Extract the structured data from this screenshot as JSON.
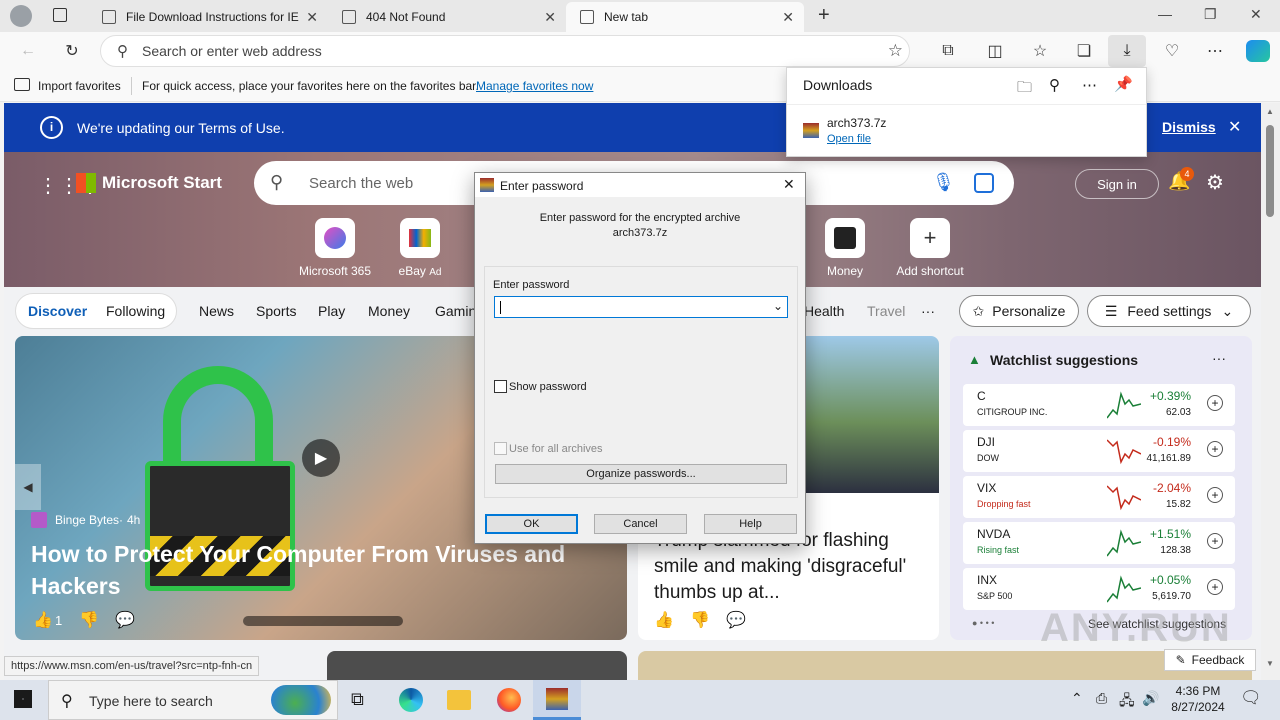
{
  "browser": {
    "tabs": [
      {
        "title": "File Download Instructions for IE",
        "active": false
      },
      {
        "title": "404 Not Found",
        "active": false
      },
      {
        "title": "New tab",
        "active": true
      }
    ],
    "address_placeholder": "Search or enter web address",
    "favorites": {
      "import_label": "Import favorites",
      "hint": "For quick access, place your favorites here on the favorites bar.",
      "manage_link": "Manage favorites now"
    }
  },
  "downloads": {
    "title": "Downloads",
    "file_name": "arch373.7z",
    "open_link": "Open file"
  },
  "banner": {
    "text": "We're updating our Terms of Use.",
    "dismiss": "Dismiss"
  },
  "msn": {
    "brand": "Microsoft Start",
    "search_placeholder": "Search the web",
    "sign_in": "Sign in",
    "notif_count": "4",
    "quicklinks": [
      {
        "label": "Microsoft 365"
      },
      {
        "label": "eBay",
        "ad": "Ad"
      },
      {
        "label": "Money"
      },
      {
        "label": "Add shortcut"
      }
    ],
    "nav": {
      "discover": "Discover",
      "following": "Following",
      "items": [
        "News",
        "Sports",
        "Play",
        "Money",
        "Gamin",
        "Health",
        "Travel"
      ],
      "more": "···",
      "personalize": "Personalize",
      "feed_settings": "Feed settings"
    },
    "feature": {
      "source": "Binge Bytes",
      "age": "4h",
      "title": "How to Protect Your Computer From Viruses and Hackers",
      "likes": "1"
    },
    "news2": {
      "title": "Trump slammed for flashing smile and making 'disgraceful' thumbs up at..."
    },
    "watchlist": {
      "title": "Watchlist suggestions",
      "more": "···",
      "items": [
        {
          "symbol": "C",
          "name": "CITIGROUP INC.",
          "change": "+0.39%",
          "price": "62.03",
          "trend": "up"
        },
        {
          "symbol": "DJI",
          "name": "DOW",
          "change": "-0.19%",
          "price": "41,161.89",
          "trend": "down"
        },
        {
          "symbol": "VIX",
          "name": "Dropping fast",
          "change": "-2.04%",
          "price": "15.82",
          "trend": "down"
        },
        {
          "symbol": "NVDA",
          "name": "Rising fast",
          "change": "+1.51%",
          "price": "128.38",
          "trend": "up"
        },
        {
          "symbol": "INX",
          "name": "S&P 500",
          "change": "+0.05%",
          "price": "5,619.70",
          "trend": "up"
        }
      ],
      "see_more": "See watchlist suggestions"
    },
    "feedback": "Feedback",
    "status_url": "https://www.msn.com/en-us/travel?src=ntp-fnh-cn"
  },
  "dialog": {
    "title": "Enter password",
    "prompt_line1": "Enter password for the encrypted archive",
    "prompt_line2": "arch373.7z",
    "field_label": "Enter password",
    "password_value": "",
    "show_password": "Show password",
    "use_all": "Use for all archives",
    "organize": "Organize passwords...",
    "ok": "OK",
    "cancel": "Cancel",
    "help": "Help"
  },
  "taskbar": {
    "search_placeholder": "Type here to search",
    "time": "4:36 PM",
    "date": "8/27/2024"
  },
  "watermark": "ANY.RUN",
  "colors": {
    "banner": "#0f3fae",
    "up": "#1a7f37",
    "down": "#c42b1c",
    "link": "#0067b8"
  }
}
